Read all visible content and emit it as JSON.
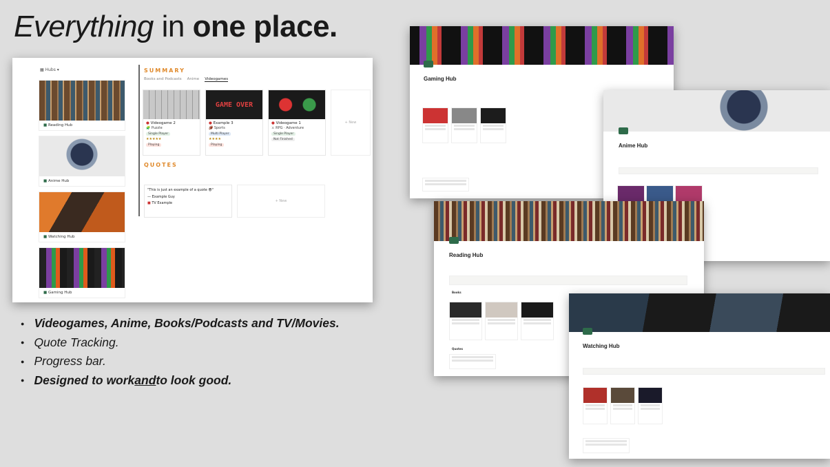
{
  "headline": {
    "part1": "Everything",
    "part2": " in ",
    "part3": "one place."
  },
  "main": {
    "sidebar_title": "Hubs",
    "hubs": [
      {
        "label": "Reading Hub"
      },
      {
        "label": "Anime Hub"
      },
      {
        "label": "Watching Hub"
      },
      {
        "label": "Gaming Hub"
      }
    ],
    "summary_title": "SUMMARY",
    "tabs": [
      "Books and Podcasts",
      "Anime",
      "Videogames"
    ],
    "games": [
      {
        "title": "Videogame 2",
        "genre": "Puzzle",
        "mode": "Single Player",
        "stars": "★★★★★",
        "status": "Playing"
      },
      {
        "title": "Example 3",
        "genre": "Sports",
        "mode": "Multi Player",
        "stars": "★★★★",
        "status": "Playing"
      },
      {
        "title": "Videogame 1",
        "genre": "RPG · Adventure",
        "mode": "Single Player",
        "stars": "",
        "status": "Not Finished"
      }
    ],
    "game_over_text": "GAME OVER",
    "new_label": "+ New",
    "quotes_title": "QUOTES",
    "quote": {
      "text": "\"This is just an example of a quote 😎\"",
      "author": "— Example Guy",
      "source": "TV Example"
    }
  },
  "bullets": [
    "Videogames, Anime, Books/Podcasts and TV/Movies.",
    "Quote Tracking.",
    "Progress bar.",
    "Designed to work ",
    "and",
    " to look good."
  ],
  "hubs_preview": {
    "gaming": "Gaming Hub",
    "anime": "Anime Hub",
    "reading": "Reading Hub",
    "watching": "Watching Hub",
    "quotes_label": "Quotes",
    "books_label": "Books"
  }
}
